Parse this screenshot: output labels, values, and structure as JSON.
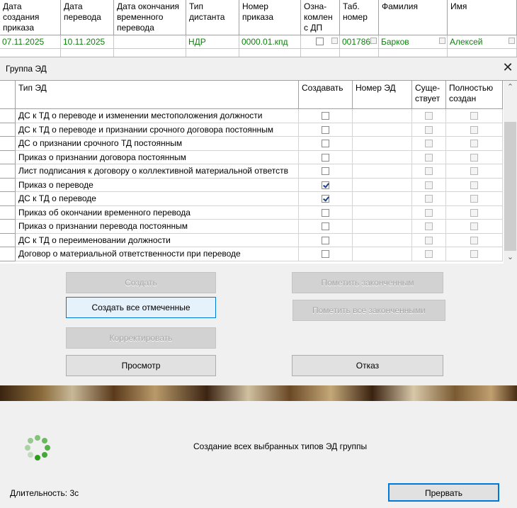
{
  "top_grid": {
    "columns": [
      {
        "label": "Дата\nсоздания\nприказа"
      },
      {
        "label": "Дата\nперевода"
      },
      {
        "label": "Дата окончания\nвременного\nперевода"
      },
      {
        "label": "Тип\nдистанта"
      },
      {
        "label": "Номер\nприказа"
      },
      {
        "label": "Озна-\nкомлен\nс ДП"
      },
      {
        "label": "Таб.\nномер"
      },
      {
        "label": "Фамилия"
      },
      {
        "label": "Имя"
      }
    ],
    "row": {
      "created": "07.11.2025",
      "transfer_date": "10.11.2025",
      "end_date": "",
      "remote_type": "НДР",
      "order_number": "0000.01.кпд",
      "acquainted": false,
      "tab_number": "001786",
      "surname": "Барков",
      "name": "Алексей"
    }
  },
  "dialog": {
    "title": "Группа ЭД",
    "close_glyph": "✕",
    "grid_headers": {
      "type": "Тип ЭД",
      "create": "Создавать",
      "number": "Номер ЭД",
      "exists": "Суще-\nствует",
      "complete": "Полностью\nсоздан"
    },
    "rows": [
      {
        "type": "ДС к ТД о переводе и изменении местоположения должности",
        "create": false
      },
      {
        "type": "ДС к ТД о переводе и признании срочного договора постоянным",
        "create": false
      },
      {
        "type": "ДС о признании срочного ТД постоянным",
        "create": false
      },
      {
        "type": "Приказ о признании договора постоянным",
        "create": false
      },
      {
        "type": "Лист подписания к договору о коллективной материальной ответств",
        "create": false
      },
      {
        "type": "Приказ о переводе",
        "create": true
      },
      {
        "type": "ДС к ТД о переводе",
        "create": true
      },
      {
        "type": "Приказ об окончании временного перевода",
        "create": false
      },
      {
        "type": "Приказ о признании перевода постоянным",
        "create": false
      },
      {
        "type": "ДС к ТД о переименовании должности",
        "create": false
      },
      {
        "type": "Договор о материальной ответственности при переводе",
        "create": false
      }
    ],
    "buttons": {
      "create": "Создать",
      "create_all": "Создать все отмеченные",
      "correct": "Корректировать",
      "view": "Просмотр",
      "mark_done": "Пометить законченным",
      "mark_all_done": "Пометить все законченными",
      "cancel": "Отказ"
    }
  },
  "progress": {
    "message": "Создание всех выбранных типов ЭД группы",
    "duration": "Длительность: 3с",
    "abort": "Прервать"
  },
  "colors": {
    "data_green": "#108010",
    "focus_blue": "#0078d7",
    "spinner_green": "#2e9e1e"
  },
  "icons": {
    "close": "close-icon",
    "spinner": "loading-spinner-icon",
    "scroll_up": "chevron-up-icon",
    "scroll_down": "chevron-down-icon"
  }
}
